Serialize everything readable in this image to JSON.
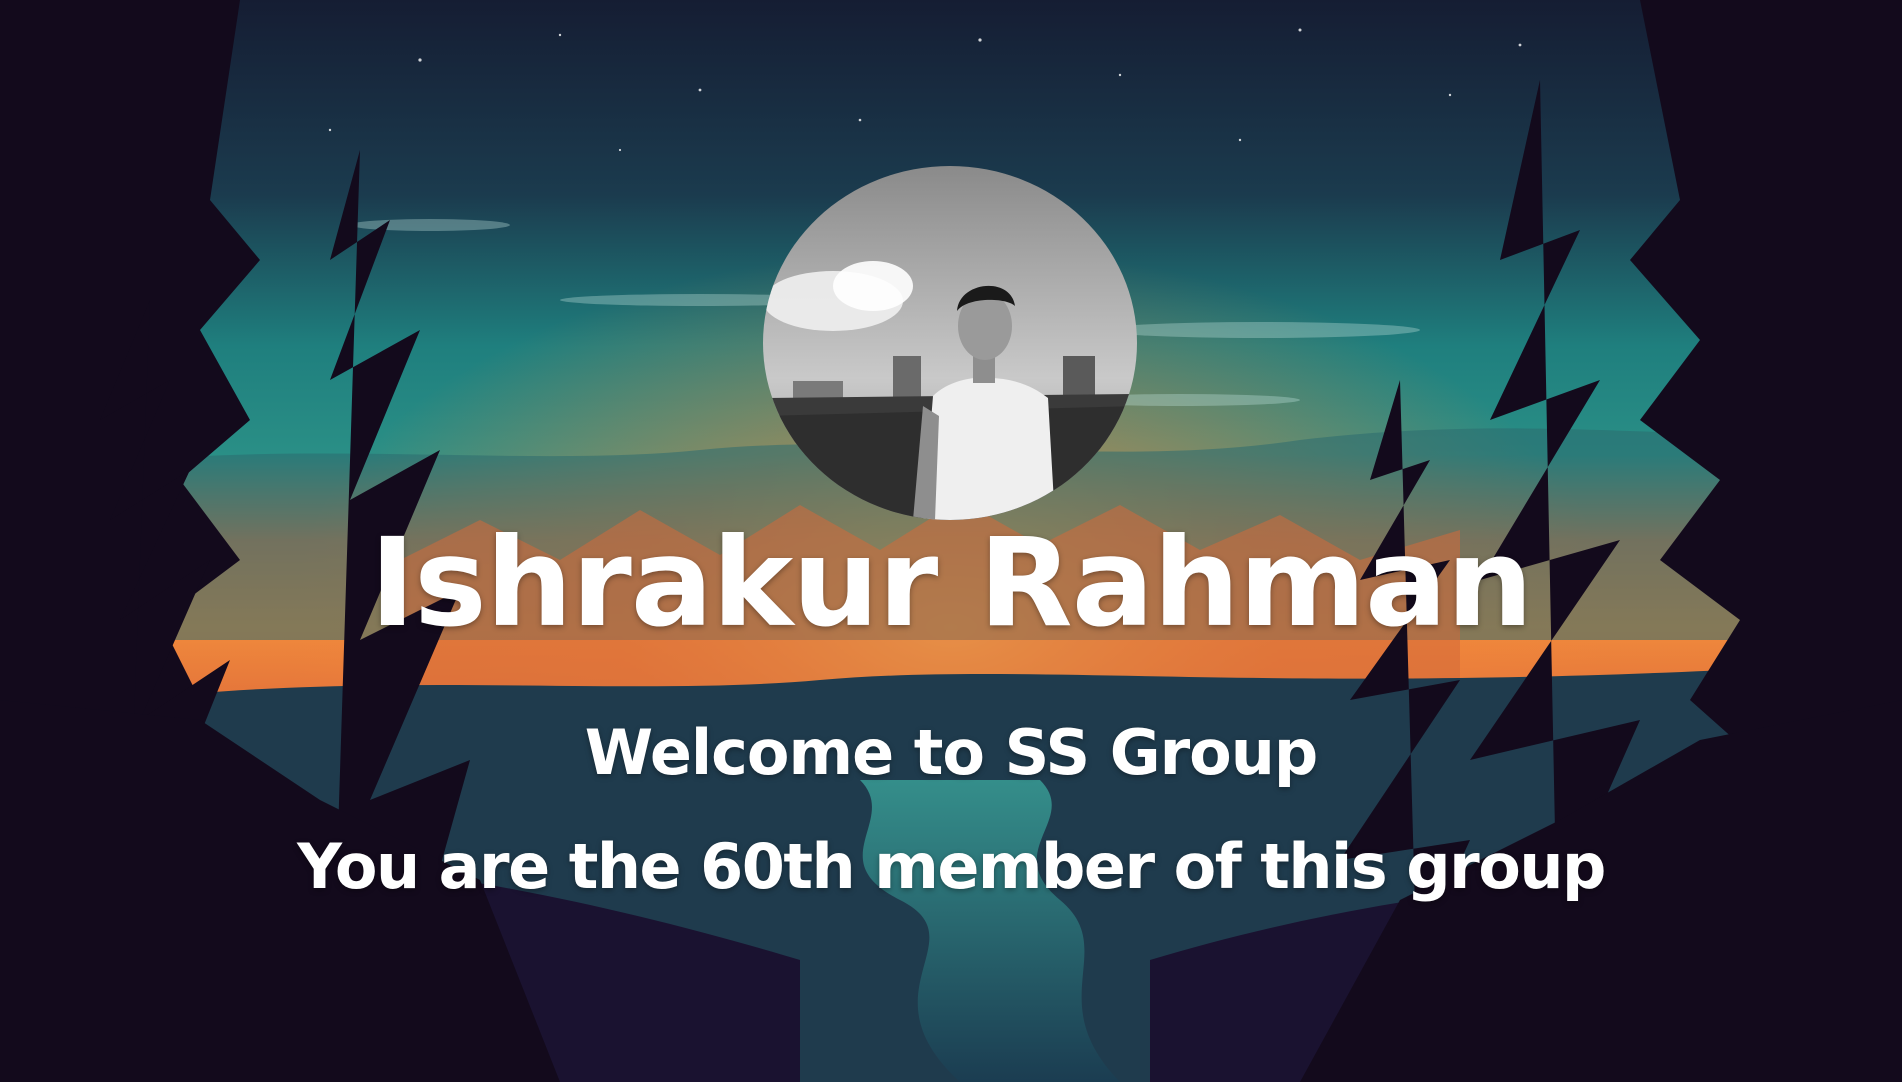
{
  "card": {
    "name": "Ishrakur Rahman",
    "welcome": "Welcome to SS Group",
    "member_message": "You are the 60th member of this group"
  },
  "avatar": {
    "description_icon": "profile-photo"
  },
  "colors": {
    "text": "#ffffff",
    "sky_top": "#14243a",
    "sky_teal": "#1f8a86",
    "sunset_orange": "#f07a3a",
    "tree_dark": "#12081a"
  }
}
